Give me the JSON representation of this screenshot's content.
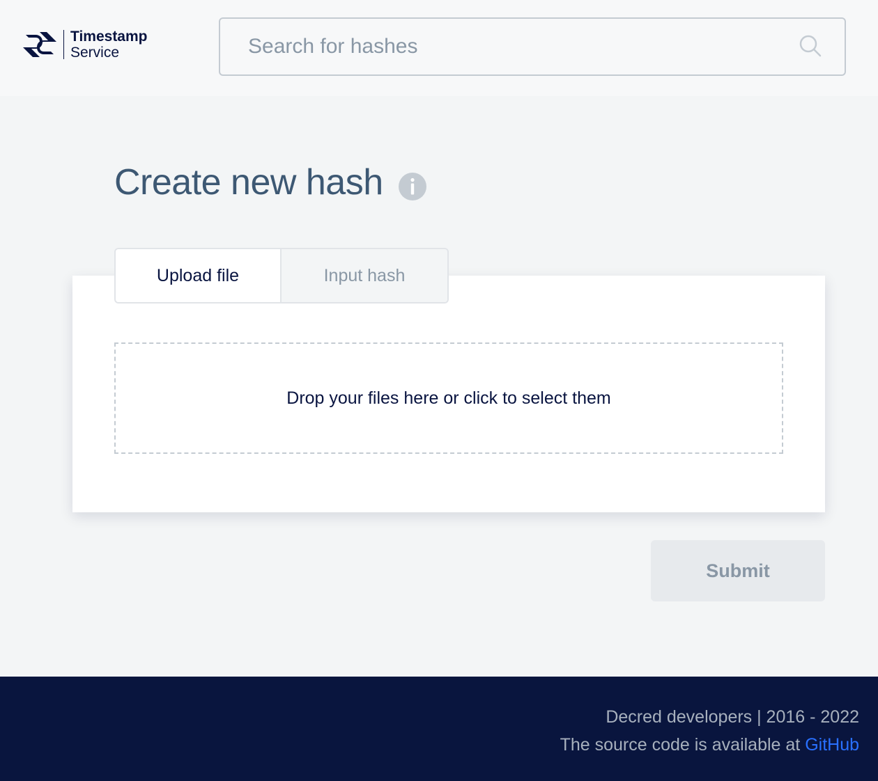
{
  "header": {
    "logo": {
      "icon": "decred-logo-icon",
      "line1": "Timestamp",
      "line2": "Service"
    },
    "search": {
      "placeholder": "Search for hashes",
      "value": "",
      "icon": "search-icon"
    }
  },
  "main": {
    "title": "Create new hash",
    "title_icon": "info-icon",
    "tabs": [
      {
        "label": "Upload file",
        "active": true
      },
      {
        "label": "Input hash",
        "active": false
      }
    ],
    "dropzone_text": "Drop your files here or click to select them",
    "submit_label": "Submit"
  },
  "footer": {
    "line1": "Decred developers | 2016 - 2022",
    "line2_prefix": "The source code is available at ",
    "link_label": "GitHub"
  },
  "colors": {
    "background": "#f3f5f6",
    "header_bg": "#f7f8f9",
    "title": "#3d5873",
    "text_dark": "#091440",
    "muted": "#8997a5",
    "footer_bg": "#09153e",
    "link": "#2970ff"
  }
}
